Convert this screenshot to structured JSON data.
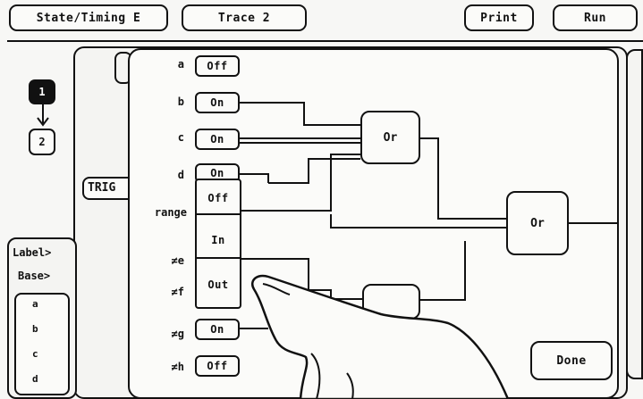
{
  "top_bar": {
    "mode": "State/Timing E",
    "trace": "Trace 2",
    "print": "Print",
    "run": "Run"
  },
  "sequence": {
    "level1": "1",
    "level2": "2"
  },
  "background": {
    "trigger_tab": "TRIG"
  },
  "left_panel": {
    "label_field": "Label>",
    "base_field": "Base>",
    "terms": [
      "a",
      "b",
      "c",
      "d"
    ]
  },
  "terms": [
    {
      "name": "a",
      "state": "Off"
    },
    {
      "name": "b",
      "state": "On"
    },
    {
      "name": "c",
      "state": "On"
    },
    {
      "name": "d",
      "state": "On"
    },
    {
      "name": "≠e",
      "state": ""
    },
    {
      "name": "≠f",
      "state": ""
    },
    {
      "name": "≠g",
      "state": "On"
    },
    {
      "name": "≠h",
      "state": "Off"
    }
  ],
  "range": {
    "label": "range",
    "options": [
      "Off",
      "In",
      "Out"
    ]
  },
  "gates": {
    "or1": "Or",
    "or_final": "Or"
  },
  "done": "Done"
}
